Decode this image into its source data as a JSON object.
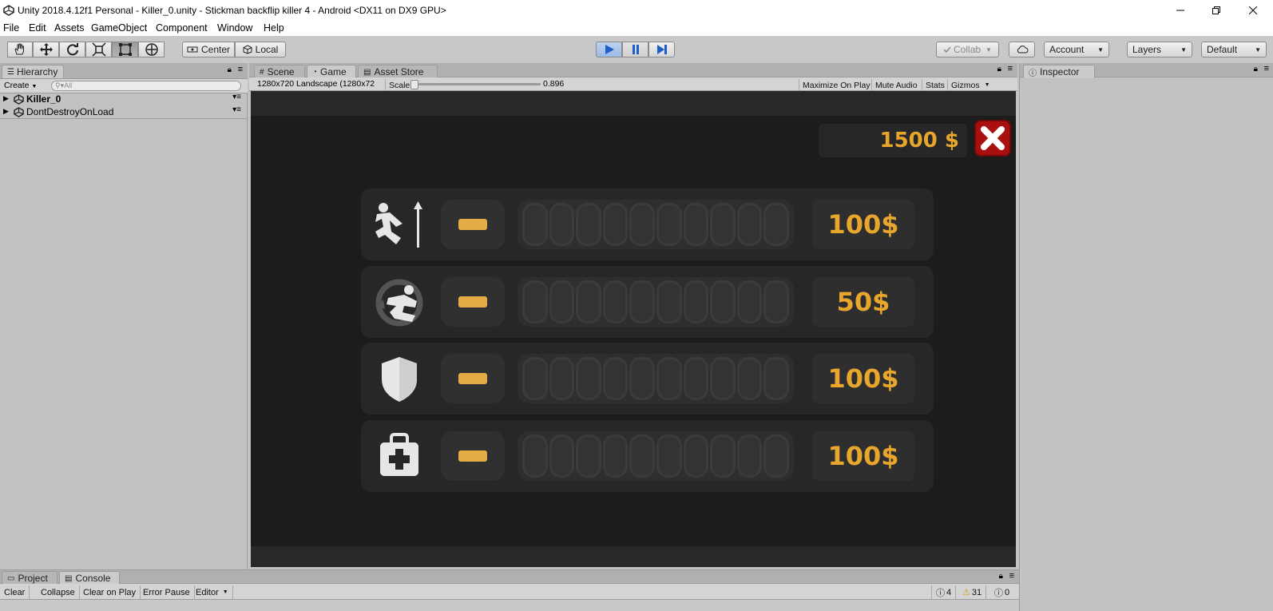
{
  "window": {
    "title": "Unity 2018.4.12f1 Personal - Killer_0.unity - Stickman backflip killer 4 - Android <DX11 on DX9 GPU>"
  },
  "menu": [
    "File",
    "Edit",
    "Assets",
    "GameObject",
    "Component",
    "Window",
    "Help"
  ],
  "toolbar": {
    "pivot": "Center",
    "space": "Local",
    "collab": "Collab",
    "account": "Account",
    "layers": "Layers",
    "layout": "Default"
  },
  "hierarchy": {
    "tab": "Hierarchy",
    "create": "Create",
    "search_placeholder": "All",
    "items": [
      "Killer_0",
      "DontDestroyOnLoad"
    ]
  },
  "center_tabs": [
    "Scene",
    "Game",
    "Asset Store"
  ],
  "gamebar": {
    "resolution": "1280x720 Landscape (1280x72",
    "scale_label": "Scale",
    "scale_value": "0.896",
    "maximize": "Maximize On Play",
    "mute": "Mute Audio",
    "stats": "Stats",
    "gizmos": "Gizmos"
  },
  "game": {
    "money": "1500 $",
    "upgrades": [
      {
        "icon": "jump-icon",
        "price": "100$"
      },
      {
        "icon": "flip-icon",
        "price": "50$"
      },
      {
        "icon": "shield-icon",
        "price": "100$"
      },
      {
        "icon": "medkit-icon",
        "price": "100$"
      }
    ]
  },
  "inspector": {
    "tab": "Inspector"
  },
  "bottom_tabs": [
    "Project",
    "Console"
  ],
  "console": {
    "buttons": [
      "Clear",
      "Collapse",
      "Clear on Play",
      "Error Pause",
      "Editor"
    ],
    "counts": {
      "info": "4",
      "warn": "31",
      "error": "0"
    }
  },
  "colors": {
    "accent_gold": "#e8a62c",
    "close_red": "#a90f0f",
    "game_bg": "#1c1c1c"
  }
}
